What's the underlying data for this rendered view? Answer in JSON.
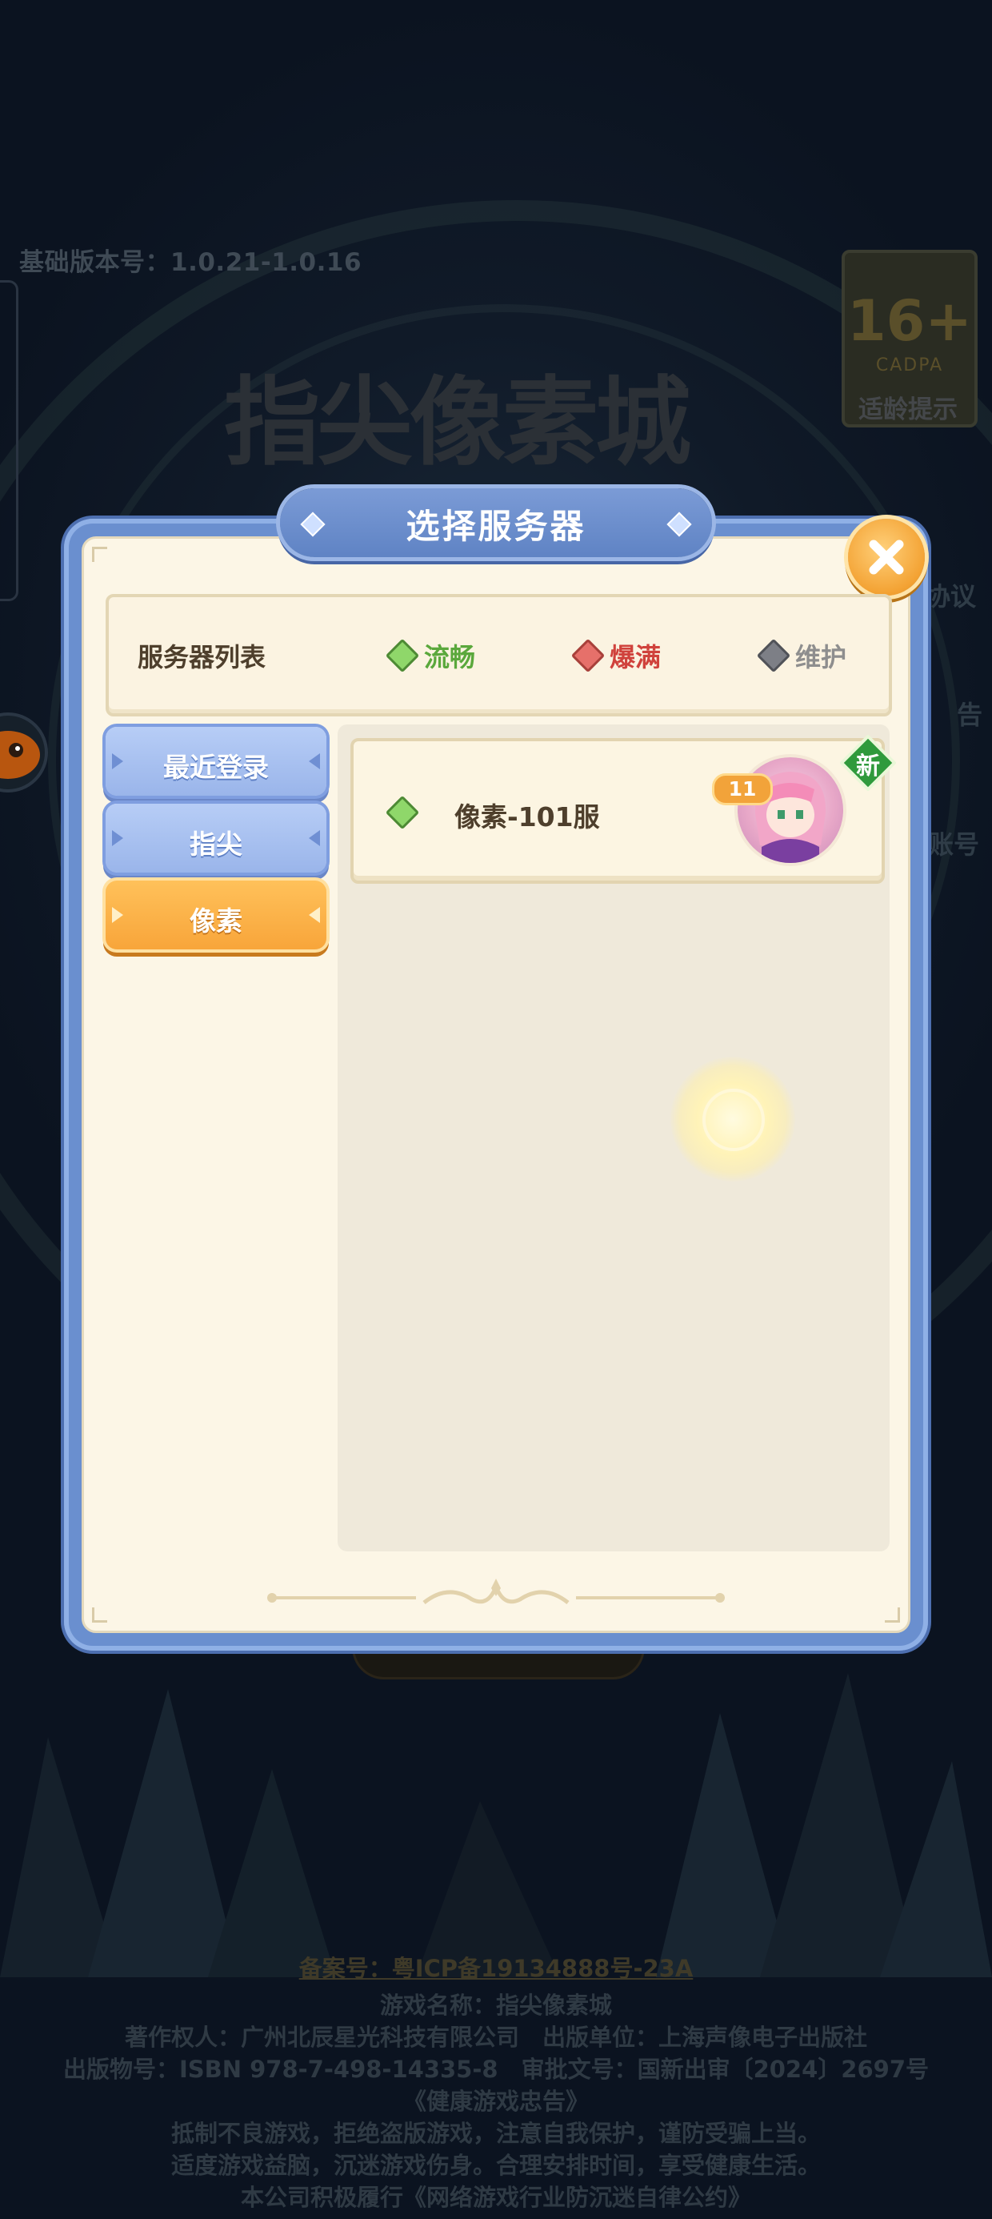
{
  "background": {
    "version_text": "基础版本号：1.0.21-1.0.16",
    "game_logo_text": "指尖像素城",
    "age_rating": {
      "number": "16+",
      "org": "CADPA",
      "label": "适龄提示"
    },
    "side_links": [
      "协议",
      "告",
      "账号"
    ],
    "footer_lines": [
      "备案号：粤ICP备19134888号-23A",
      "游戏名称：指尖像素城",
      "著作权人：广州北辰星光科技有限公司　出版单位：上海声像电子出版社",
      "出版物号：ISBN 978-7-498-14335-8　审批文号：国新出审〔2024〕2697号",
      "《健康游戏忠告》",
      "抵制不良游戏，拒绝盗版游戏，注意自我保护，谨防受骗上当。",
      "适度游戏益脑，沉迷游戏伤身。合理安排时间，享受健康生活。",
      "本公司积极履行《网络游戏行业防沉迷自律公约》"
    ]
  },
  "dialog": {
    "title": "选择服务器",
    "legend": {
      "label": "服务器列表",
      "items": [
        {
          "text": "流畅",
          "color": "#5aa83c",
          "diamond": "#8fd76a"
        },
        {
          "text": "爆满",
          "color": "#d0423c",
          "diamond": "#e6706a"
        },
        {
          "text": "维护",
          "color": "#8e8e8e",
          "diamond": "#7d7f86"
        }
      ]
    },
    "tabs": [
      {
        "label": "最近登录",
        "active": false
      },
      {
        "label": "指尖",
        "active": false
      },
      {
        "label": "像素",
        "active": true
      }
    ],
    "servers": [
      {
        "name": "像素-101服",
        "status": "流畅",
        "level": "11",
        "badge": "新"
      }
    ]
  },
  "colors": {
    "dialog_frame": "#6a8fcf",
    "panel_cream": "#fcf6e6",
    "tab_blue": "#9ab5ea",
    "tab_orange": "#f8a53a",
    "close_button": "#f3a233",
    "new_badge": "#2f9a3c"
  },
  "icons": {
    "close": "close-x-icon",
    "status": "diamond-status-icon",
    "new": "new-badge-icon",
    "loading": "loading-ring-icon"
  }
}
